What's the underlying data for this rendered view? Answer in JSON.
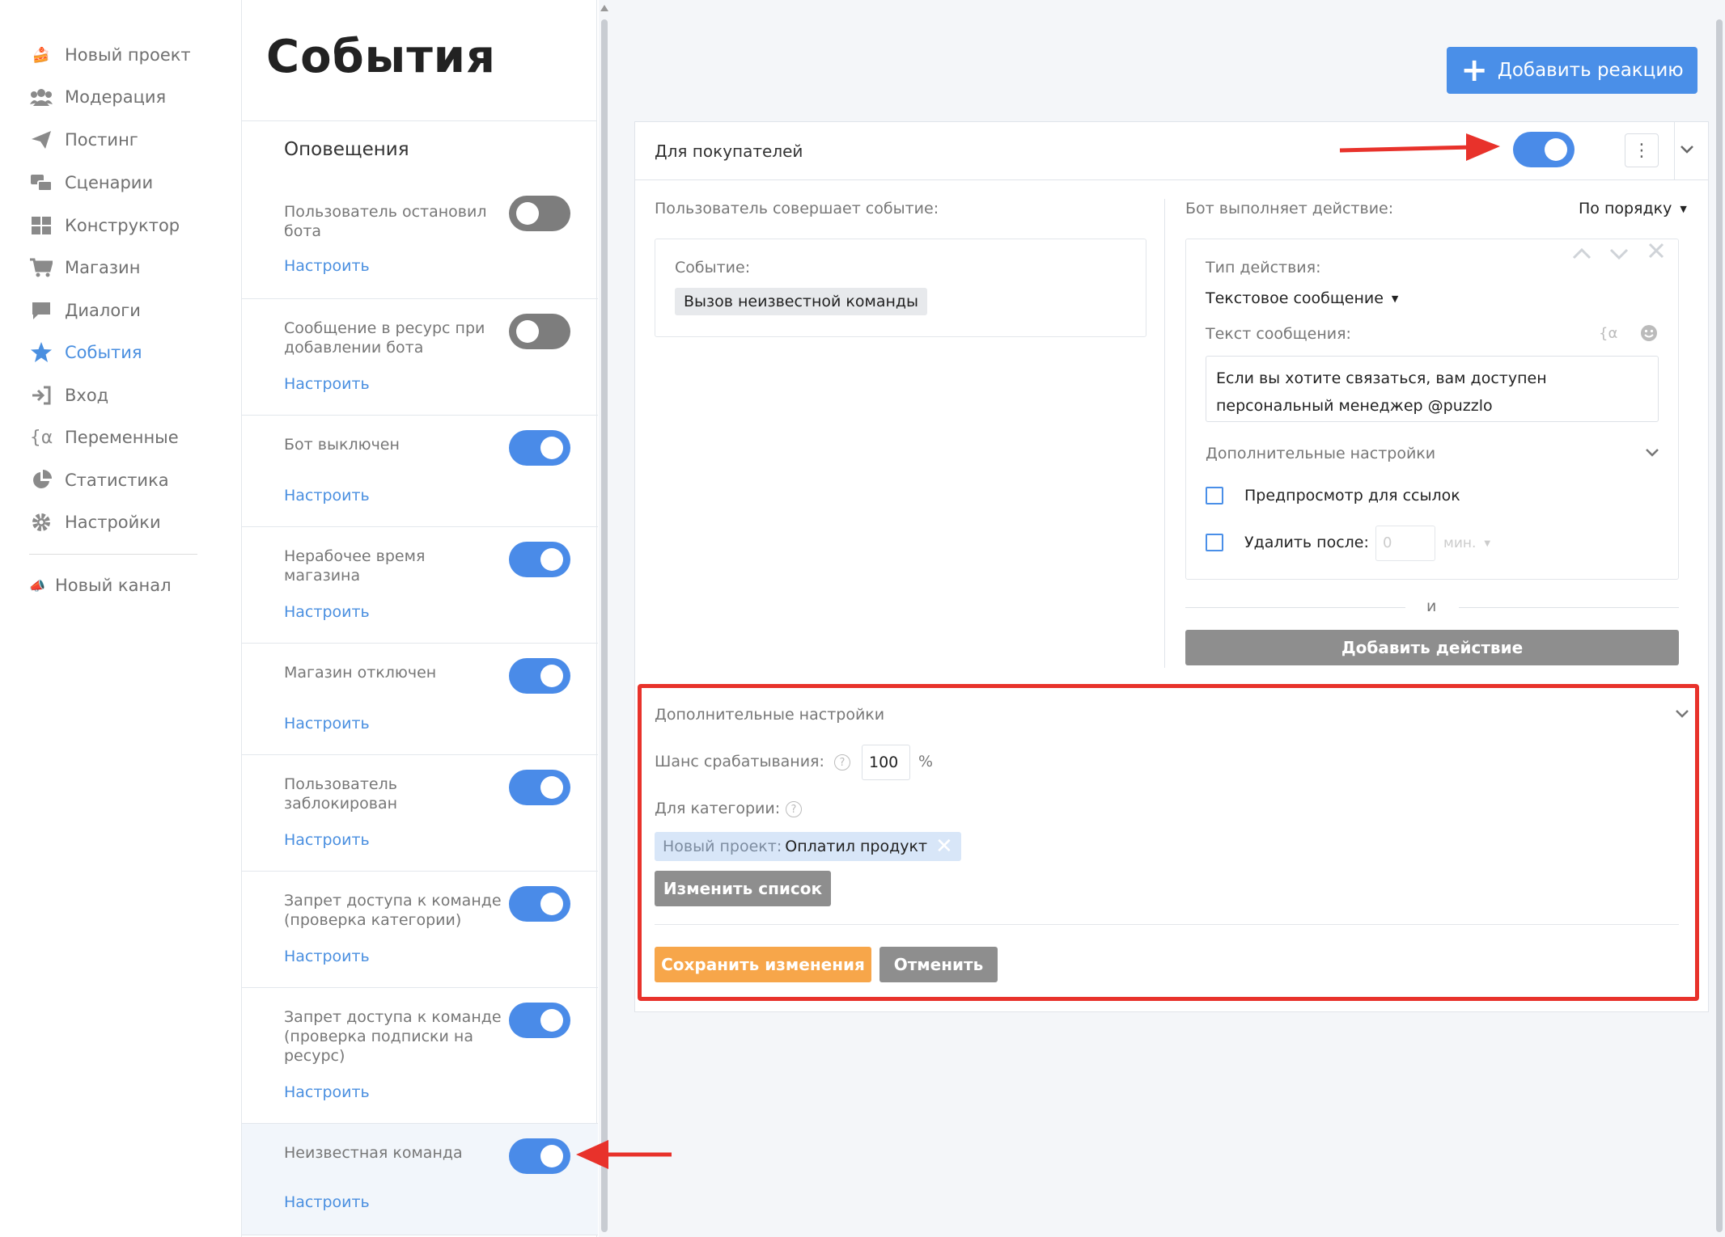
{
  "nav": {
    "items": [
      {
        "label": "Новый проект",
        "icon": "cake-icon"
      },
      {
        "label": "Модерация",
        "icon": "users-icon"
      },
      {
        "label": "Постинг",
        "icon": "paper-plane-icon"
      },
      {
        "label": "Сценарии",
        "icon": "scenarios-icon"
      },
      {
        "label": "Конструктор",
        "icon": "grid-icon"
      },
      {
        "label": "Магазин",
        "icon": "cart-icon"
      },
      {
        "label": "Диалоги",
        "icon": "chat-bubble-icon"
      },
      {
        "label": "События",
        "icon": "star-icon",
        "active": true
      },
      {
        "label": "Вход",
        "icon": "sign-in-icon"
      },
      {
        "label": "Переменные",
        "icon": "variable-icon"
      },
      {
        "label": "Статистика",
        "icon": "pie-chart-icon"
      },
      {
        "label": "Настройки",
        "icon": "gear-icon"
      }
    ],
    "new_channel": {
      "label": "Новый канал",
      "icon": "megaphone-icon"
    }
  },
  "events_panel": {
    "title": "События",
    "section": "Оповещения",
    "configure_label": "Настроить",
    "items": [
      {
        "name": "Пользователь остановил бота",
        "enabled": false
      },
      {
        "name": "Сообщение в ресурс при добавлении бота",
        "enabled": false
      },
      {
        "name": "Бот выключен",
        "enabled": true
      },
      {
        "name": "Нерабочее время магазина",
        "enabled": true
      },
      {
        "name": "Магазин отключен",
        "enabled": true
      },
      {
        "name": "Пользователь заблокирован",
        "enabled": true
      },
      {
        "name": "Запрет доступа к команде (проверка категории)",
        "enabled": true
      },
      {
        "name": "Запрет доступа к команде (проверка подписки на ресурс)",
        "enabled": true
      },
      {
        "name": "Неизвестная команда",
        "enabled": true,
        "selected": true
      }
    ]
  },
  "main": {
    "add_reaction_label": "Добавить реакцию",
    "reaction": {
      "title": "Для покупателей",
      "enabled": true,
      "user_event_label": "Пользователь совершает событие:",
      "event_label": "Событие:",
      "event_value": "Вызов неизвестной команды",
      "bot_action_label": "Бот выполняет действие:",
      "order_value": "По порядку",
      "action": {
        "type_label": "Тип действия:",
        "type_value": "Текстовое сообщение",
        "text_label": "Текст сообщения:",
        "text_line1": "Если вы хотите связаться, вам доступен",
        "text_line2": "персональный менеджер @puzzlo",
        "advanced_label": "Дополнительные настройки",
        "preview_label": "Предпросмотр для ссылок",
        "delete_label": "Удалить после:",
        "delete_placeholder": "0",
        "delete_unit": "мин."
      },
      "and_label": "и",
      "add_action_label": "Добавить действие",
      "advanced": {
        "title": "Дополнительные настройки",
        "chance_label": "Шанс срабатывания:",
        "chance_value": "100",
        "chance_unit": "%",
        "category_label": "Для категории:",
        "tag_project": "Новый проект:",
        "tag_category": "Оплатил продукт",
        "change_list_label": "Изменить список"
      },
      "save_label": "Сохранить изменения",
      "cancel_label": "Отменить"
    }
  },
  "colors": {
    "accent": "#4a8fe8",
    "orange": "#f7a64a",
    "annotation_red": "#e8322b"
  }
}
